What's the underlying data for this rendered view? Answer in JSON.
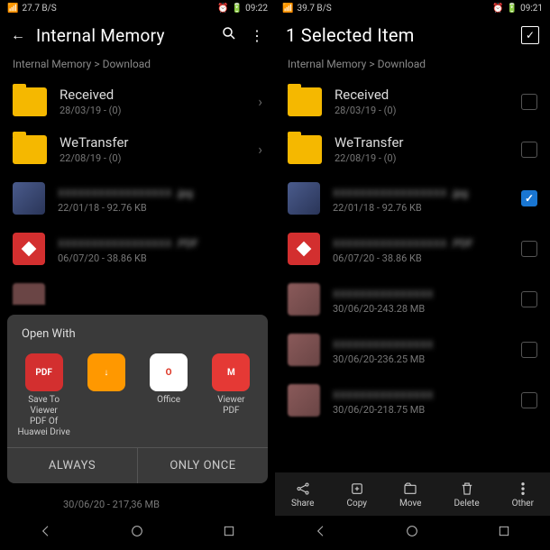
{
  "left": {
    "status": {
      "net": "27.7 B/S",
      "time": "09:22"
    },
    "title": "Internal Memory",
    "breadcrumb": "Internal Memory > Download",
    "items": [
      {
        "type": "folder",
        "name": "Received",
        "meta": "28/03/19 - (0)"
      },
      {
        "type": "folder",
        "name": "WeTransfer",
        "meta": "22/08/19 - (0)"
      },
      {
        "type": "img",
        "ext": ".jpg",
        "meta": "22/01/18 - 92.76 KB"
      },
      {
        "type": "pdf",
        "ext": ".PDF",
        "meta": "06/07/20 - 38.86 KB"
      }
    ],
    "partial_meta": "30/06/20 - 217,36 MB",
    "sheet": {
      "title": "Open With",
      "apps": [
        {
          "label": "Save To Viewer",
          "sub": "PDF Of Huawei Drive",
          "color": "#d32f2f",
          "txt": "PDF"
        },
        {
          "label": "",
          "sub": "",
          "color": "#ff9800",
          "txt": "↓"
        },
        {
          "label": "Office",
          "sub": "",
          "color": "#fff",
          "txt": "O"
        },
        {
          "label": "Viewer",
          "sub": "PDF",
          "color": "#e53935",
          "txt": "M"
        }
      ],
      "always": "ALWAYS",
      "once": "ONLY ONCE"
    }
  },
  "right": {
    "status": {
      "net": "39.7 B/S",
      "time": "09:21"
    },
    "title": "1 Selected Item",
    "breadcrumb": "Internal Memory > Download",
    "items": [
      {
        "type": "folder",
        "name": "Received",
        "meta": "28/03/19 - (0)",
        "checked": false
      },
      {
        "type": "folder",
        "name": "WeTransfer",
        "meta": "22/08/19 - (0)",
        "checked": false
      },
      {
        "type": "img",
        "ext": ".jpg",
        "meta": "22/01/18 - 92.76 KB",
        "checked": true
      },
      {
        "type": "pdf",
        "ext": ".PDF",
        "meta": "06/07/20 - 38.86 KB",
        "checked": false
      },
      {
        "type": "blur",
        "meta": "30/06/20-243.28 MB",
        "checked": false
      },
      {
        "type": "blur",
        "meta": "30/06/20-236.25 MB",
        "checked": false
      },
      {
        "type": "blur",
        "meta": "30/06/20-218.75 MB",
        "checked": false
      }
    ],
    "actions": [
      {
        "label": "Share"
      },
      {
        "label": "Copy"
      },
      {
        "label": "Move"
      },
      {
        "label": "Delete"
      },
      {
        "label": "Other"
      }
    ]
  }
}
